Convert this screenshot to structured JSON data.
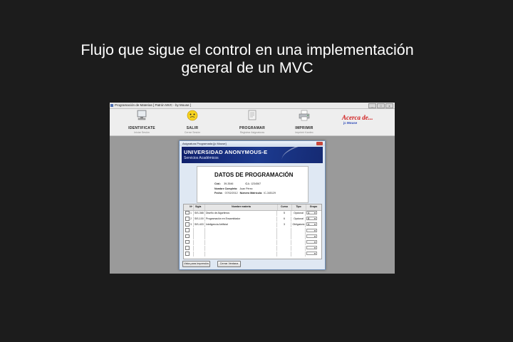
{
  "slide": {
    "title_line1": "Flujo que sigue el control en una implementación",
    "title_line2": "general de un MVC"
  },
  "window": {
    "title": "Programación de Materias [ Patrón MVC - by Mouse ]",
    "controls": [
      "_",
      "□",
      "x"
    ]
  },
  "toolbar": {
    "items": [
      {
        "label": "IDENTIFICATE",
        "sub": "Iniciar Sesión",
        "icon": "monitor-icon"
      },
      {
        "label": "SALIR",
        "sub": "Cerrar Sesión",
        "icon": "smiley-icon"
      },
      {
        "label": "PROGRAMAR",
        "sub": "Registrar Asignaturas",
        "icon": "document-icon"
      },
      {
        "label": "IMPRIMIR",
        "sub": "Imprimir Kardex",
        "icon": "printer-icon"
      }
    ],
    "about_title": "Acerca de...",
    "about_sub": "jc Mouse"
  },
  "dialog": {
    "title": "Asignatura Programada [jc Mouse]",
    "banner_title": "UNIVERSIDAD ANONYMOUS-E",
    "banner_sub": "Servicios Académicos",
    "heading": "DATOS DE PROGRAMACIÓN",
    "cod_label": "Cód.:",
    "cod_value": "39-3546",
    "ci_label": "C.I.:",
    "ci_value": "1234567",
    "name_label": "Nombre Completo:",
    "name_value": "Juan Pérez",
    "fecha_label": "Fecha:",
    "fecha_value": "07/02/2012",
    "matricula_label": "Número Matrícula:",
    "matricula_value": "IC-345129",
    "table": {
      "headers": [
        "Nº",
        "Sigla",
        "Nombre materia",
        "Curso",
        "Tipo",
        "Grupo"
      ],
      "rows": [
        {
          "num": "1",
          "sigla": "SIS-368",
          "nombre": "Diseño de Algoritmos",
          "curso": "5",
          "tipo": "Opcional",
          "grupo": "A"
        },
        {
          "num": "2",
          "sigla": "SIS-100",
          "nombre": "Programación en Ensamblador",
          "curso": "6",
          "tipo": "Opcional",
          "grupo": "B"
        },
        {
          "num": "3",
          "sigla": "SIS-403",
          "nombre": "Inteligencia Artificial",
          "curso": "3",
          "tipo": "Obligatorio",
          "grupo": "A"
        }
      ],
      "empty_rows": 5
    },
    "btn_print": "Vista para Impresión",
    "btn_close": "Cerrar Ventana"
  }
}
